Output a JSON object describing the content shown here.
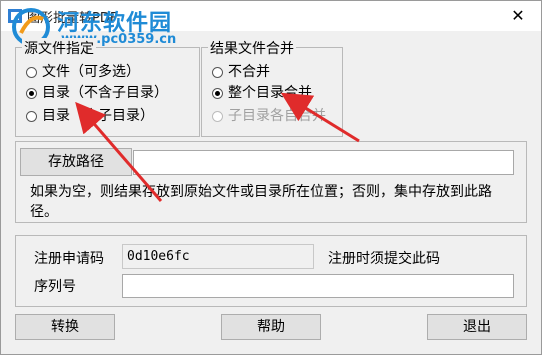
{
  "window": {
    "title": "图形批量转PDF",
    "close_glyph": "✕"
  },
  "watermark": {
    "name": "河东软件园",
    "url": "www.pc0359.cn"
  },
  "source_group": {
    "legend": "源文件指定",
    "options": [
      {
        "label": "文件（可多选）",
        "checked": false,
        "disabled": false
      },
      {
        "label": "目录（不含子目录）",
        "checked": true,
        "disabled": false
      },
      {
        "label": "目录（含子目录）",
        "checked": false,
        "disabled": false
      }
    ]
  },
  "merge_group": {
    "legend": "结果文件合并",
    "options": [
      {
        "label": "不合并",
        "checked": false,
        "disabled": false
      },
      {
        "label": "整个目录合并",
        "checked": true,
        "disabled": false
      },
      {
        "label": "子目录各自合并",
        "checked": false,
        "disabled": true
      }
    ]
  },
  "output": {
    "button_label": "存放路径",
    "path_value": "",
    "hint": "如果为空，则结果存放到原始文件或目录所在位置；否则，集中存放到此路径。"
  },
  "registration": {
    "request_label": "注册申请码",
    "request_code": "0d10e6fc",
    "request_hint": "注册时须提交此码",
    "serial_label": "序列号",
    "serial_value": ""
  },
  "footer": {
    "convert_label": "转换",
    "help_label": "帮助",
    "exit_label": "退出"
  },
  "colors": {
    "arrow": "#e02b2b",
    "watermark": "#1f8bd6"
  }
}
